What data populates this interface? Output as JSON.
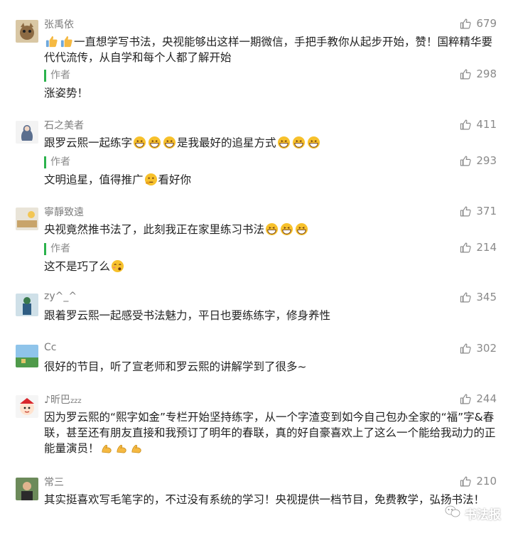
{
  "comments": [
    {
      "user": "张禹依",
      "likes": "679",
      "text_parts": [
        "",
        "一直想学写书法，央视能够出这样一期微信，手把手教你从起步开始，赞！国粹精华要代代流传，从自学和每个人都了解开始"
      ],
      "reply": {
        "label": "作者",
        "likes": "298",
        "text": "涨姿势！"
      }
    },
    {
      "user": "石之美者",
      "likes": "411",
      "text_parts": [
        "跟罗云熙一起练字",
        "是我最好的追星方式",
        ""
      ],
      "reply": {
        "label": "作者",
        "likes": "293",
        "text_a": "文明追星，值得推广",
        "text_b": "看好你"
      }
    },
    {
      "user": "寧靜致遠",
      "likes": "371",
      "text_parts": [
        "央视竟然推书法了，此刻我正在家里练习书法"
      ],
      "reply": {
        "label": "作者",
        "likes": "214",
        "text": "这不是巧了么"
      }
    },
    {
      "user": "zy^_^",
      "likes": "345",
      "text_parts": [
        "跟着罗云熙一起感受书法魅力，平日也要练练字，修身养性"
      ]
    },
    {
      "user": "Cc",
      "likes": "302",
      "text_parts": [
        "很好的节目，听了宣老师和罗云熙的讲解学到了很多~"
      ]
    },
    {
      "user": "昕巴",
      "user_suffix": "zzz",
      "likes": "244",
      "text_parts": [
        "因为罗云熙的“熙字如金”专栏开始坚持练字，从一个字渣变到如今自己包办全家的“福”字&春联，甚至还有朋友直接和我预订了明年的春联，真的好自豪喜欢上了这么一个能给我动力的正能量演员！"
      ]
    },
    {
      "user": "常三",
      "likes": "210",
      "text_parts": [
        "其实挺喜欢写毛笔字的，不过没有系统的学习！央视提供一档节目，免费教学，弘扬书法！"
      ]
    }
  ],
  "watermark": "书法报",
  "icons": {
    "like": "thumbs-up-icon",
    "grin": "grinning-emoji",
    "thumb": "thumbs-up-emoji",
    "thinking": "thinking-emoji",
    "wink": "smirk-emoji",
    "muscle": "flexed-biceps-emoji"
  },
  "colors": {
    "reply_bar": "#2bb24c",
    "meta_text": "#8a8a8a",
    "body_text": "#222222"
  }
}
